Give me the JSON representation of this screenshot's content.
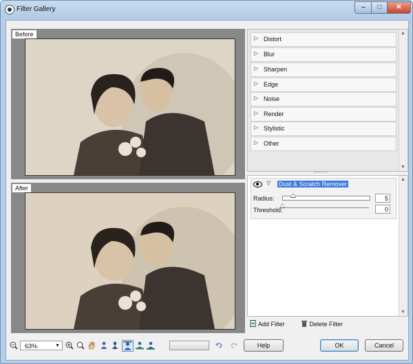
{
  "window": {
    "title": "Filter Gallery",
    "controls": {
      "minimize": "–",
      "maximize": "□",
      "close": "✕"
    }
  },
  "previews": {
    "before_label": "Before",
    "after_label": "After"
  },
  "categories": [
    {
      "label": "Distort"
    },
    {
      "label": "Blur"
    },
    {
      "label": "Sharpen"
    },
    {
      "label": "Edge"
    },
    {
      "label": "Noise"
    },
    {
      "label": "Render"
    },
    {
      "label": "Stylistic"
    },
    {
      "label": "Other"
    }
  ],
  "effect": {
    "name": "Dust & Scratch Remover",
    "params": [
      {
        "label": "Radius:",
        "value": "5",
        "level": 0.12
      },
      {
        "label": "Threshold:",
        "value": "0",
        "level": 0.0
      }
    ]
  },
  "effect_actions": {
    "add": "Add Filter",
    "delete": "Delete Filter"
  },
  "toolbar": {
    "zoom": "63%"
  },
  "buttons": {
    "help": "Help",
    "ok": "OK",
    "cancel": "Cancel"
  },
  "icons": {
    "app": "filter-gallery-icon",
    "zoom_out": "zoom-out-icon",
    "zoom_in": "zoom-in-icon",
    "zoom_fit": "magnifier-icon",
    "pan": "hand-icon",
    "view_single": "person-single-icon",
    "view_split": "person-split-icon",
    "view_before_after": "person-compare-icon",
    "view_compare": "person-two-icon",
    "view_after": "person-after-icon",
    "undo": "undo-icon",
    "redo": "redo-icon",
    "add_filter": "add-document-icon",
    "delete_filter": "trash-icon",
    "eye": "eye-icon"
  },
  "colors": {
    "selection": "#3a78d8",
    "window_frame": "#b5cde6",
    "close_button": "#c8442a"
  }
}
